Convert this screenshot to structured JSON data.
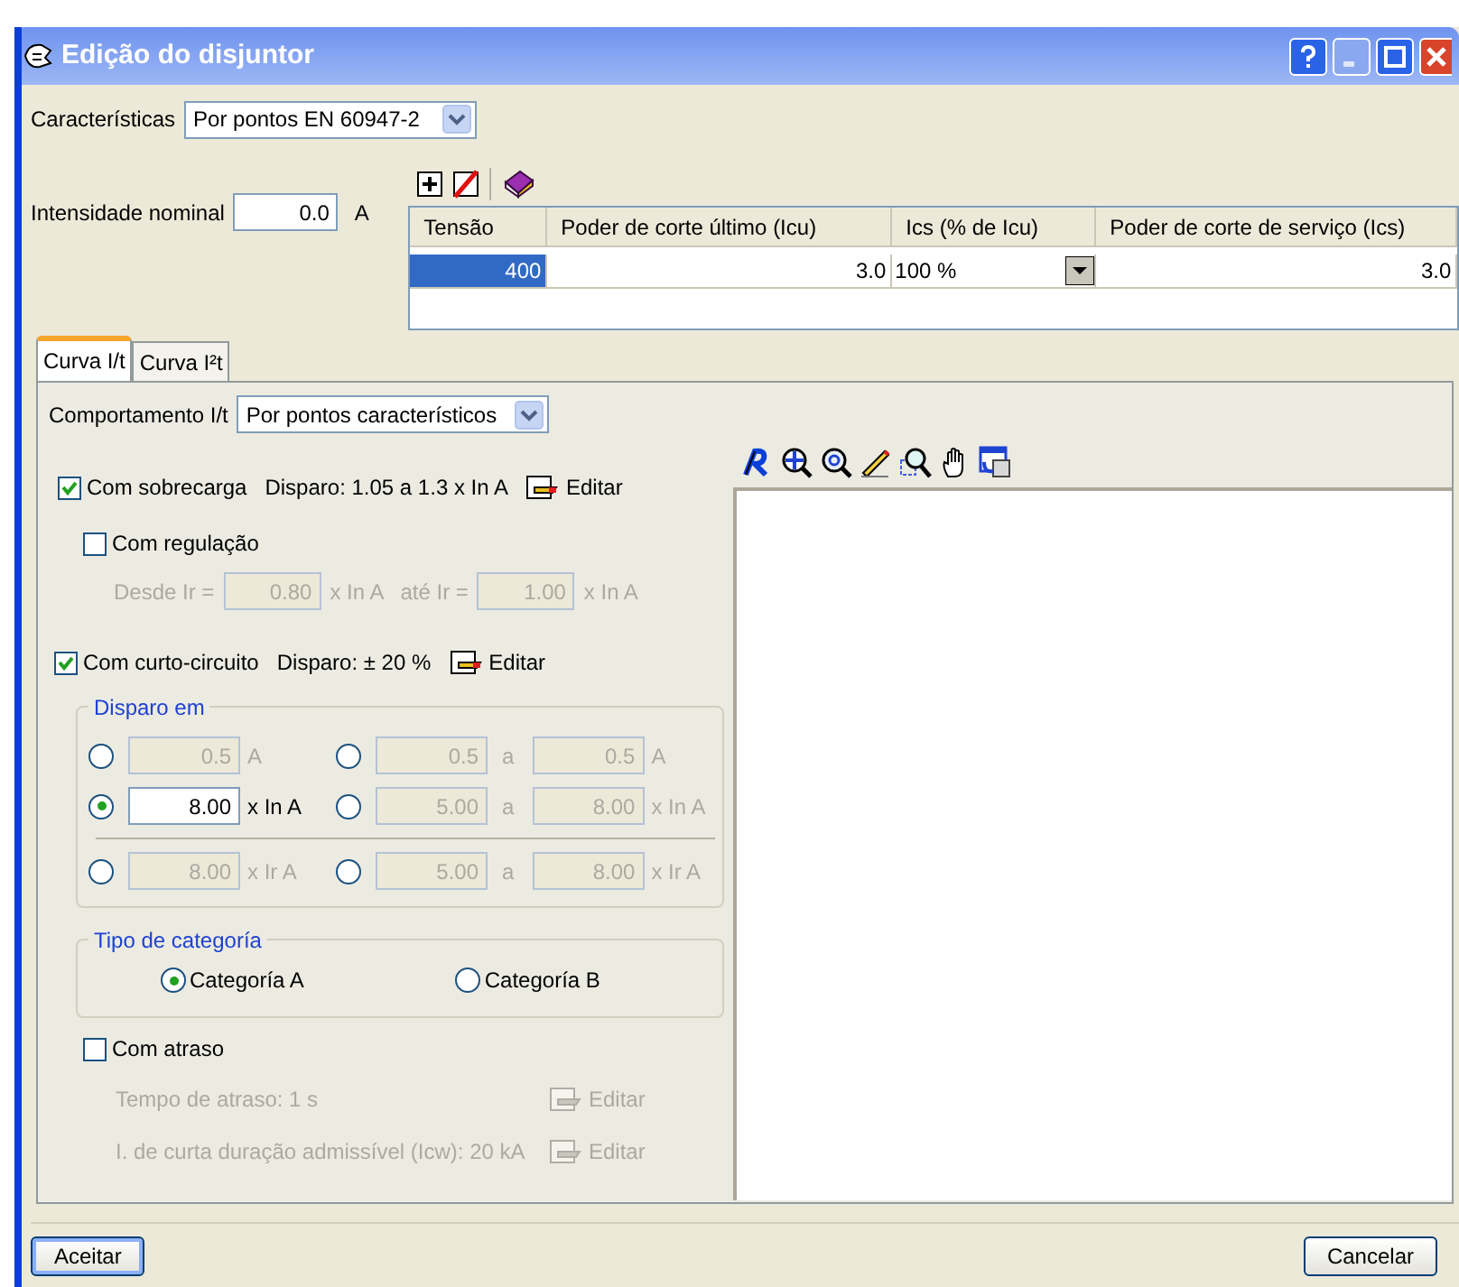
{
  "window": {
    "title": "Edição do disjuntor"
  },
  "caracteristicas": {
    "label": "Características",
    "value": "Por pontos EN 60947-2"
  },
  "intensidade": {
    "label": "Intensidade nominal",
    "value": "0.0",
    "unit": "A"
  },
  "table": {
    "columns": [
      "Tensão",
      "Poder de corte último (Icu)",
      "Ics (% de Icu)",
      "Poder de corte de serviço (Ics)"
    ],
    "rows": [
      {
        "cells": [
          "400",
          "3.0",
          "100 %",
          "3.0"
        ],
        "selected": true
      }
    ]
  },
  "tabs": [
    {
      "label": "Curva I/t",
      "selected": true
    },
    {
      "label": "Curva I²t",
      "selected": false
    }
  ],
  "comportamento": {
    "label": "Comportamento I/t",
    "value": "Por pontos característicos"
  },
  "sobrecarga": {
    "label": "Com sobrecarga",
    "checked": true,
    "info": "Disparo: 1.05 a 1.3 x In A",
    "edit": "Editar"
  },
  "regulacao": {
    "label": "Com regulação",
    "checked": false,
    "from_label": "Desde Ir =",
    "from_value": "0.80",
    "from_unit": "x In A",
    "to_label": "até Ir =",
    "to_value": "1.00",
    "to_unit": "x In A"
  },
  "curto": {
    "label": "Com curto-circuito",
    "checked": true,
    "info": "Disparo: ± 20 %",
    "edit": "Editar"
  },
  "disparo_em": {
    "title": "Disparo em",
    "rows": [
      {
        "options": [
          {
            "kind": "single",
            "selected": false,
            "value": "0.5",
            "unit": "A"
          },
          {
            "kind": "range",
            "selected": false,
            "from": "0.5",
            "sep": "a",
            "to": "0.5",
            "unit": "A"
          }
        ]
      },
      {
        "options": [
          {
            "kind": "single",
            "selected": true,
            "value": "8.00",
            "unit": "x In A"
          },
          {
            "kind": "range",
            "selected": false,
            "from": "5.00",
            "sep": "a",
            "to": "8.00",
            "unit": "x In A"
          }
        ]
      },
      {
        "options": [
          {
            "kind": "single",
            "selected": false,
            "value": "8.00",
            "unit": "x Ir A"
          },
          {
            "kind": "range",
            "selected": false,
            "from": "5.00",
            "sep": "a",
            "to": "8.00",
            "unit": "x Ir A"
          }
        ]
      }
    ]
  },
  "categoria": {
    "title": "Tipo de categoría",
    "options": [
      {
        "label": "Categoría A",
        "selected": true
      },
      {
        "label": "Categoría B",
        "selected": false
      }
    ]
  },
  "atraso": {
    "label": "Com atraso",
    "checked": false,
    "items": [
      {
        "text": "Tempo de atraso: 1 s",
        "edit": "Editar"
      },
      {
        "text": "I. de curta duração admissível (Icw): 20 kA",
        "edit": "Editar"
      }
    ]
  },
  "buttons": [
    {
      "label": "Aceitar"
    },
    {
      "label": "Cancelar"
    }
  ]
}
